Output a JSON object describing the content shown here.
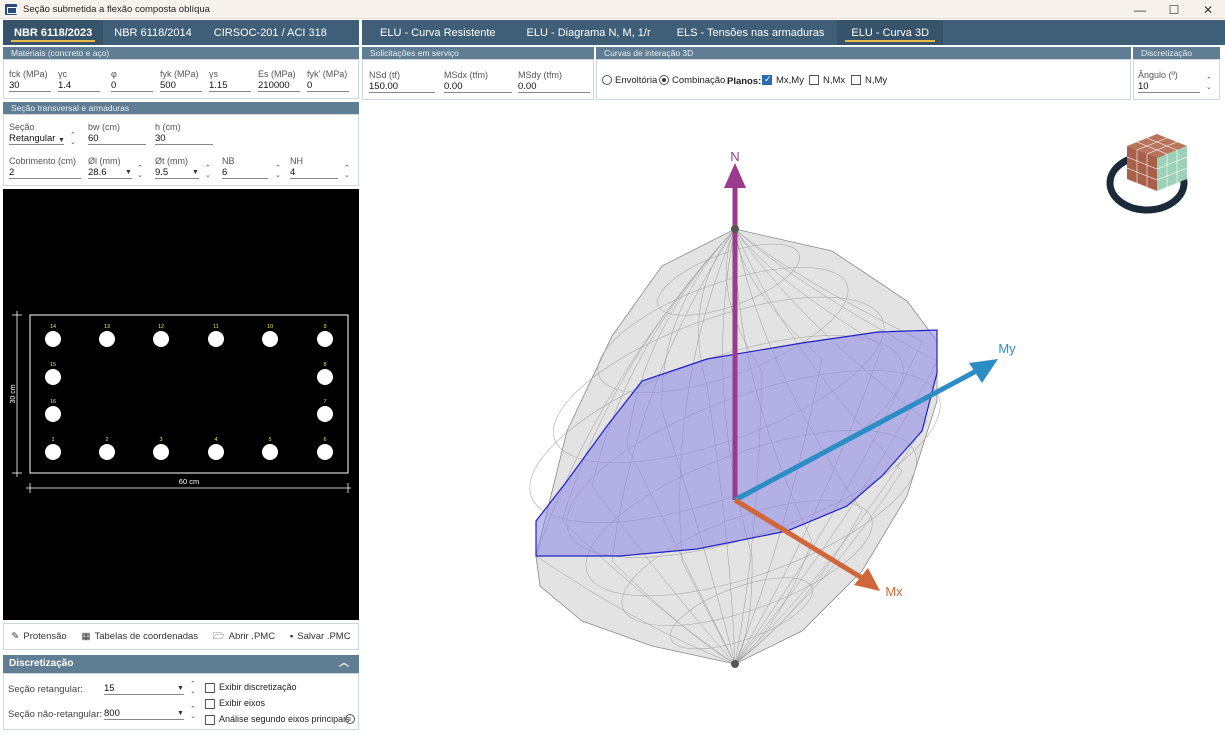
{
  "window": {
    "title": "Seção submetida a flexão composta oblíqua",
    "controls": [
      "—",
      "☐",
      "✕"
    ]
  },
  "left_tabs": [
    "NBR 6118/2023",
    "NBR 6118/2014",
    "CIRSOC-201 / ACI 318"
  ],
  "right_tabs": [
    "ELU - Curva Resistente",
    "ELU - Diagrama N, M, 1/r",
    "ELS - Tensões nas armaduras",
    "ELU - Curva 3D"
  ],
  "materials": {
    "header": "Materiais (concreto e aço)",
    "fields": [
      {
        "label": "fck (MPa)",
        "value": "30"
      },
      {
        "label": "γc",
        "value": "1.4"
      },
      {
        "label": "φ",
        "value": "0"
      },
      {
        "label": "fyk (MPa)",
        "value": "500"
      },
      {
        "label": "γs",
        "value": "1.15"
      },
      {
        "label": "Es (MPa)",
        "value": "210000"
      },
      {
        "label": "fyk' (MPa)",
        "value": "0"
      }
    ]
  },
  "section": {
    "header": "Seção transversal e armaduras",
    "secao_label": "Seção",
    "secao_value": "Retangular",
    "bw_label": "bw (cm)",
    "bw_value": "60",
    "h_label": "h (cm)",
    "h_value": "30",
    "cob_label": "Cobrimento (cm)",
    "cob_value": "2",
    "phil_label": "Øl (mm)",
    "phil_value": "28.6",
    "phit_label": "Øt (mm)",
    "phit_value": "9.5",
    "nb_label": "NB",
    "nb_value": "6",
    "nh_label": "NH",
    "nh_value": "4"
  },
  "drawing": {
    "width_label": "60  cm",
    "height_label": "30  cm",
    "bars": [
      {
        "n": "14"
      },
      {
        "n": "13"
      },
      {
        "n": "12"
      },
      {
        "n": "11"
      },
      {
        "n": "10"
      },
      {
        "n": "9"
      },
      {
        "n": "15"
      },
      {
        "n": "8"
      },
      {
        "n": "16"
      },
      {
        "n": "7"
      },
      {
        "n": "1"
      },
      {
        "n": "2"
      },
      {
        "n": "3"
      },
      {
        "n": "4"
      },
      {
        "n": "5"
      },
      {
        "n": "6"
      }
    ]
  },
  "toolbar": {
    "protensao": "Protensão",
    "tabelas": "Tabelas de coordenadas",
    "abrir": "Abrir .PMC",
    "salvar": "Salvar .PMC"
  },
  "discretizacao": {
    "title": "Discretização",
    "ret_label": "Seção retangular:",
    "ret_value": "15",
    "nret_label": "Seção não-retangular:",
    "nret_value": "800",
    "chk1": "Exibir discretização",
    "chk2": "Exibir eixos",
    "chk3": "Análise segundo eixos principais"
  },
  "solicitacoes": {
    "header": "Solicitações em serviço",
    "nsd_label": "NSd (tf)",
    "nsd_value": "150.00",
    "msdx_label": "MSdx (tfm)",
    "msdx_value": "0.00",
    "msdy_label": "MSdy (tfm)",
    "msdy_value": "0.00"
  },
  "interacao": {
    "header": "Curvas de interação 3D",
    "envoltoria": "Envoltória",
    "combinacao": "Combinação",
    "planos": "Planos:",
    "p1": "Mx,My",
    "p2": "N,Mx",
    "p3": "N,My"
  },
  "disc3d": {
    "header": "Discretização",
    "angulo_label": "Ângulo (º)",
    "angulo_value": "10"
  },
  "view3d": {
    "axis_n": "N",
    "axis_my": "My",
    "axis_mx": "Mx",
    "colors": {
      "n": "#9b3a8e",
      "my": "#2b8dc4",
      "mx": "#d0673a",
      "plane": "#7b78e6",
      "mesh": "#9a9a9a"
    }
  }
}
